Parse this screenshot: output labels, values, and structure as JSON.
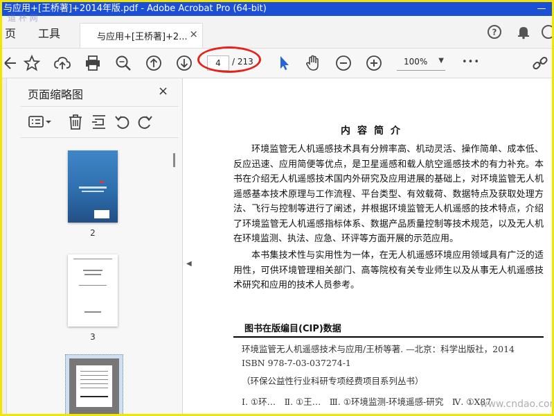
{
  "window": {
    "title": "与应用+[王桥著]+2014年版.pdf - Adobe Acrobat Pro (64-bit)"
  },
  "menu": {
    "left_partial": "页",
    "tools": "工具"
  },
  "tab": {
    "label": "与应用+[王桥著]+2...",
    "close": "×"
  },
  "toolbar": {
    "current_page": "4",
    "page_total": "/ 213",
    "zoom": "100%",
    "more": "•••"
  },
  "panel": {
    "title": "页面缩略图",
    "close": "×",
    "thumbnails": [
      {
        "label": "2"
      },
      {
        "label": "3"
      }
    ]
  },
  "document": {
    "heading": "内容简介",
    "paragraphs": [
      "环境监管无人机遥感技术具有分辨率高、机动灵活、操作简单、成本低、反应迅速、应用简便等优点，是卫星遥感和载人航空遥感技术的有力补充。本书在介绍无人机遥感技术国内外研究及应用进展的基础上，对环境监管无人机遥感基本技术原理与工作流程、平台类型、有效载荷、数据特点及获取处理方法、飞行与控制等进行了阐述，并根据环境监管无人机遥感的技术特点，介绍了环境监管无人机遥感指标体系、数据产品质量控制等技术规范，以及无人机在环境监测、执法、应急、环评等方面开展的示范应用。",
      "本书集技术性与实用性为一体，在无人机遥感环境应用领域具有广泛的适用性，可供环境管理相关部门、高等院校有关专业师生以及从事无人机遥感技术研究和应用的技术人员参考。"
    ],
    "cip": {
      "title": "图书在版编目(CIP)数据",
      "line1": "环境监管无人机遥感技术与应用/王桥等著. —北京：科学出版社，2014",
      "line2": "ISBN 978-7-03-037274-1",
      "line3": "（环保公益性行业科研专项经费项目系列丛书）",
      "line4": "Ⅰ. ①环…　Ⅱ. ①王…　Ⅲ. ①环境监测-环境遥感-研究　Ⅳ. ①X87"
    }
  },
  "watermarks": {
    "top_left": "道 杯 网",
    "bottom_right": "www.cndao.com"
  }
}
